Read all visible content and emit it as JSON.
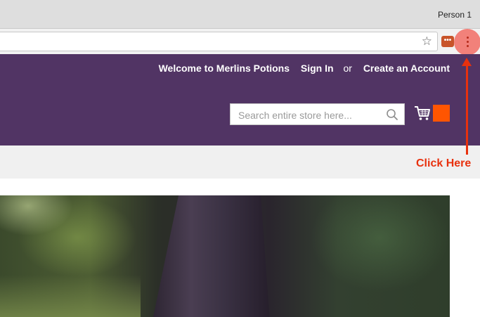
{
  "browser": {
    "profile_name": "Person 1",
    "bookmark_icon": "star-icon",
    "extension_label": "•••",
    "menu_icon": "kebab-menu-icon"
  },
  "header": {
    "welcome": "Welcome to Merlins Potions",
    "sign_in": "Sign In",
    "or": "or",
    "create_account": "Create an Account",
    "background_color": "#513464"
  },
  "search": {
    "placeholder": "Search entire store here...",
    "value": ""
  },
  "cart": {
    "icon": "cart-icon",
    "badge_color": "#ff5501"
  },
  "annotation": {
    "label": "Click Here",
    "color": "#e8310e"
  }
}
